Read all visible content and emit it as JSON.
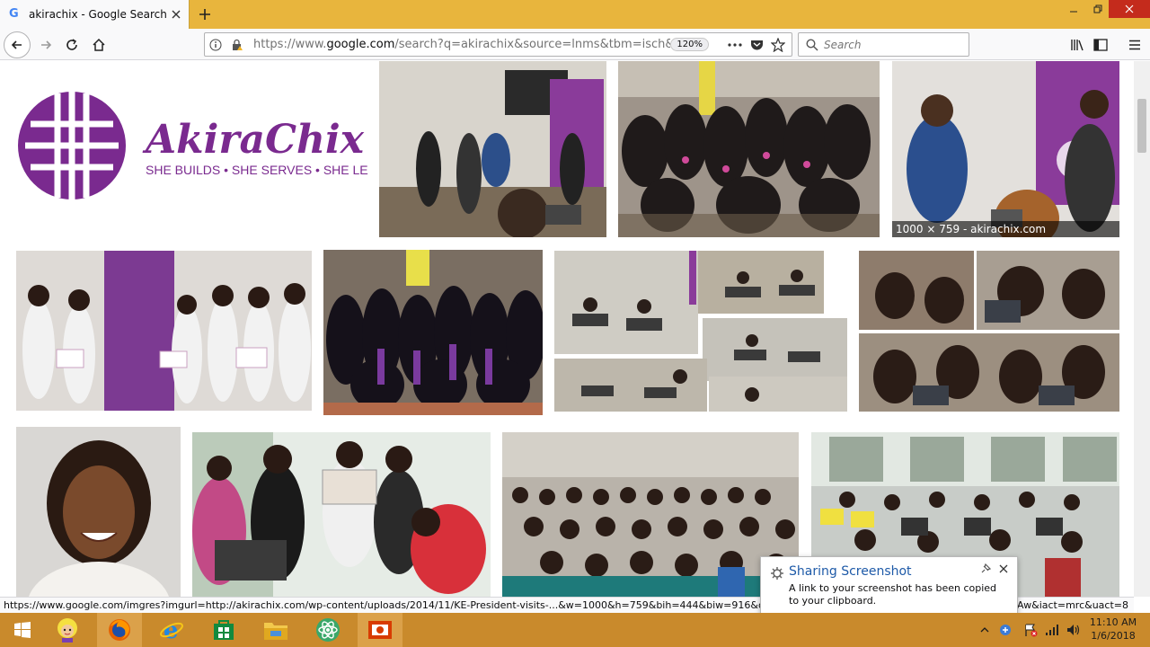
{
  "browser": {
    "tab": {
      "title": "akirachix - Google Search",
      "favicon": "google-g-icon"
    },
    "url": {
      "prefix": "https://www.",
      "host": "google.com",
      "path": "/search?q=akirachix&source=lnms&tbm=isch&sa="
    },
    "zoom": "120%",
    "search_placeholder": "Search"
  },
  "content": {
    "logo": {
      "brand": "AkiraChix",
      "tagline": "SHE BUILDS • SHE SERVES • SHE LEADS"
    },
    "hover_caption": "1000 × 759 - akirachix.com",
    "images": [
      "akirachix-logo",
      "presentation-room",
      "group-photo-black-shirts",
      "ke-president-visit",
      "certificates-group",
      "graduation-gowns",
      "training-room-collage",
      "laptop-classes-collage",
      "portrait-smiling-woman",
      "girls-with-laptops",
      "auditorium-audience",
      "computer-lab"
    ]
  },
  "status_bar": "https://www.google.com/imgres?imgurl=http://akirachix.com/wp-content/uploads/2014/11/KE-President-visits-...&w=1000&h=759&bih=444&biw=916&q=akirachix&ve",
  "status_bar_right": "wAw&iact=mrc&uact=8",
  "toast": {
    "title": "Sharing Screenshot",
    "body": "A link to your screenshot has been copied to your clipboard."
  },
  "taskbar": {
    "apps": [
      "windows-start",
      "user-avatar",
      "firefox",
      "internet-explorer",
      "store",
      "file-explorer",
      "atom",
      "screenshot-tool"
    ]
  },
  "clock": {
    "time": "11:10 AM",
    "date": "1/6/2018"
  },
  "colors": {
    "tabbar": "#e8b53d",
    "taskbar": "#c98a2c",
    "akira_purple": "#7a2a8f"
  }
}
